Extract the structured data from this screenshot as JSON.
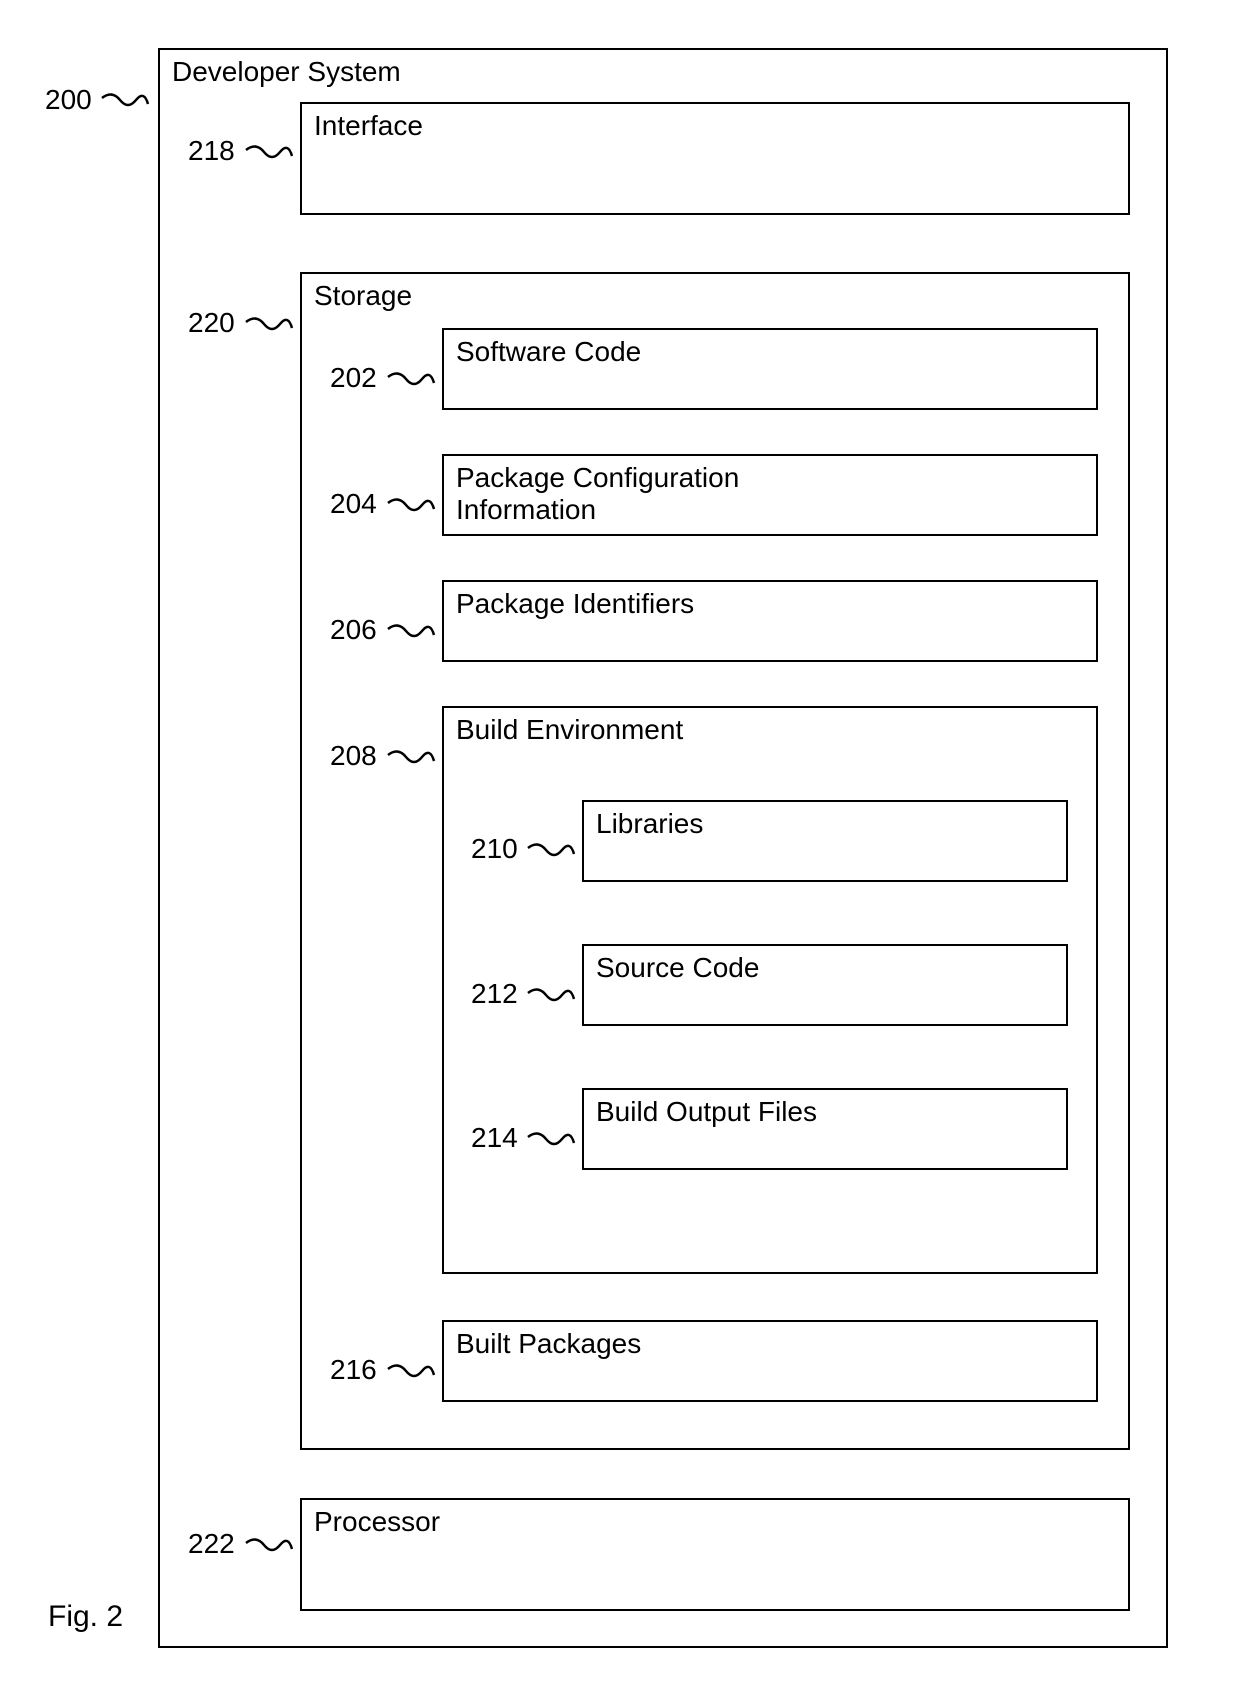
{
  "figure_label": "Fig. 2",
  "developer_system": {
    "label": "Developer System",
    "ref": "200"
  },
  "interface": {
    "label": "Interface",
    "ref": "218"
  },
  "storage": {
    "label": "Storage",
    "ref": "220"
  },
  "software_code": {
    "label": "Software Code",
    "ref": "202"
  },
  "package_config": {
    "label": "Package Configuration Information",
    "ref": "204"
  },
  "package_identifiers": {
    "label": "Package Identifiers",
    "ref": "206"
  },
  "build_environment": {
    "label": "Build Environment",
    "ref": "208"
  },
  "libraries": {
    "label": "Libraries",
    "ref": "210"
  },
  "source_code": {
    "label": "Source Code",
    "ref": "212"
  },
  "build_output_files": {
    "label": "Build Output Files",
    "ref": "214"
  },
  "built_packages": {
    "label": "Built Packages",
    "ref": "216"
  },
  "processor": {
    "label": "Processor",
    "ref": "222"
  }
}
